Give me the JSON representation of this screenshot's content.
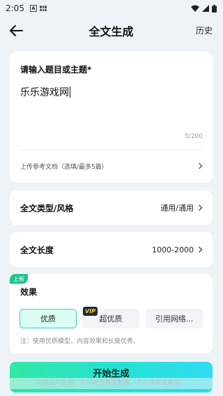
{
  "status_bar": {
    "time": "2:05",
    "notif_a": "A"
  },
  "header": {
    "title": "全文生成",
    "history_label": "历史"
  },
  "topic": {
    "label": "请输入题目或主题*",
    "value": "乐乐游戏网",
    "char_count": "5/200",
    "upload_label": "上传参考文档（选填/最多5篇）"
  },
  "type_row": {
    "label": "全文类型/风格",
    "value": "通用/通用"
  },
  "length_row": {
    "label": "全文长度",
    "value": "1000-2000"
  },
  "effect": {
    "new_badge": "上新",
    "label": "效果",
    "options": [
      "优质",
      "超优质",
      "引用网络..."
    ],
    "vip_badge": "VIP",
    "note": "注：使用优质模型，内容效果和长度优秀。"
  },
  "start_button_label": "开始生成",
  "disclaimer": "内容由AI生成，不可视为真实数据，不可作非法用途。",
  "colors": {
    "accent": "#28d9b2",
    "selected_bg": "#dafcf2",
    "badge_green": "#1fc58a"
  }
}
